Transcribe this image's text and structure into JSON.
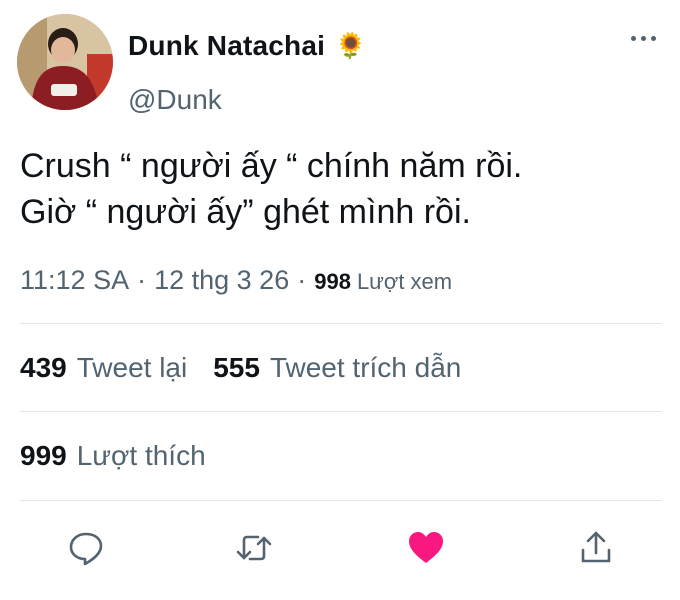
{
  "author": {
    "display_name": "Dunk Natachai",
    "badge_emoji": "🌻",
    "handle": "@Dunk"
  },
  "tweet": {
    "lines": [
      "Crush “ người ấy “ chính năm rồi.",
      "Giờ “ người ấy” ghét mình rồi."
    ]
  },
  "meta": {
    "time": "11:12 SA",
    "date": "12 thg 3 26",
    "separator": "·",
    "views_count": "998",
    "views_label": "Lượt xem"
  },
  "stats": {
    "retweets_count": "439",
    "retweets_label": "Tweet lại",
    "quotes_count": "555",
    "quotes_label": "Tweet trích dẫn",
    "likes_count": "999",
    "likes_label": "Lượt thích"
  },
  "icons": {
    "reply": "reply-icon",
    "retweet": "retweet-icon",
    "like": "heart-icon",
    "share": "share-icon",
    "more": "more-icon"
  },
  "colors": {
    "like_active": "#f91880",
    "secondary_text": "#536471",
    "primary_text": "#0f1419"
  }
}
